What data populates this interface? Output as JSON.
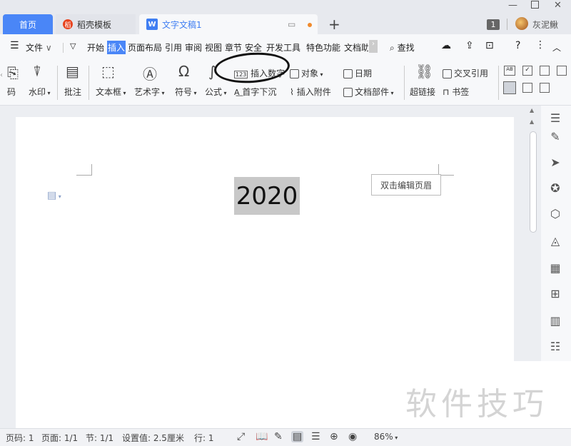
{
  "tabs": {
    "home": "首页",
    "docer": "稻壳模板",
    "docer_icon": "稻",
    "doc": "文字文稿1",
    "doc_icon": "W",
    "new_tab": "+"
  },
  "window": {
    "notification_count": "1",
    "username": "灰泥鳅"
  },
  "menu": {
    "file": "文件",
    "items": [
      "开始",
      "插入",
      "页面布局",
      "引用",
      "审阅",
      "视图",
      "章节",
      "安全",
      "开发工具",
      "特色功能",
      "文档助"
    ],
    "active": "插入",
    "search": "查找"
  },
  "ribbon": {
    "watermark_partial": "码",
    "watermark": "水印",
    "comment": "批注",
    "textbox": "文本框",
    "wordart": "艺术字",
    "symbol": "符号",
    "formula": "公式",
    "insert_number": "插入数字",
    "drop_cap": "首字下沉",
    "object": "对象",
    "attachment": "插入附件",
    "date": "日期",
    "doc_parts": "文档部件",
    "hyperlink": "超链接",
    "cross_ref": "交叉引用",
    "bookmark": "书签"
  },
  "document": {
    "year_text": "2020",
    "header_hint": "双击编辑页眉"
  },
  "watermark_text": "软件技巧",
  "status": {
    "page_num": "页码: 1",
    "pages": "页面: 1/1",
    "section": "节: 1/1",
    "setting": "设置值: 2.5厘米",
    "line": "行: 1",
    "zoom": "86%"
  }
}
